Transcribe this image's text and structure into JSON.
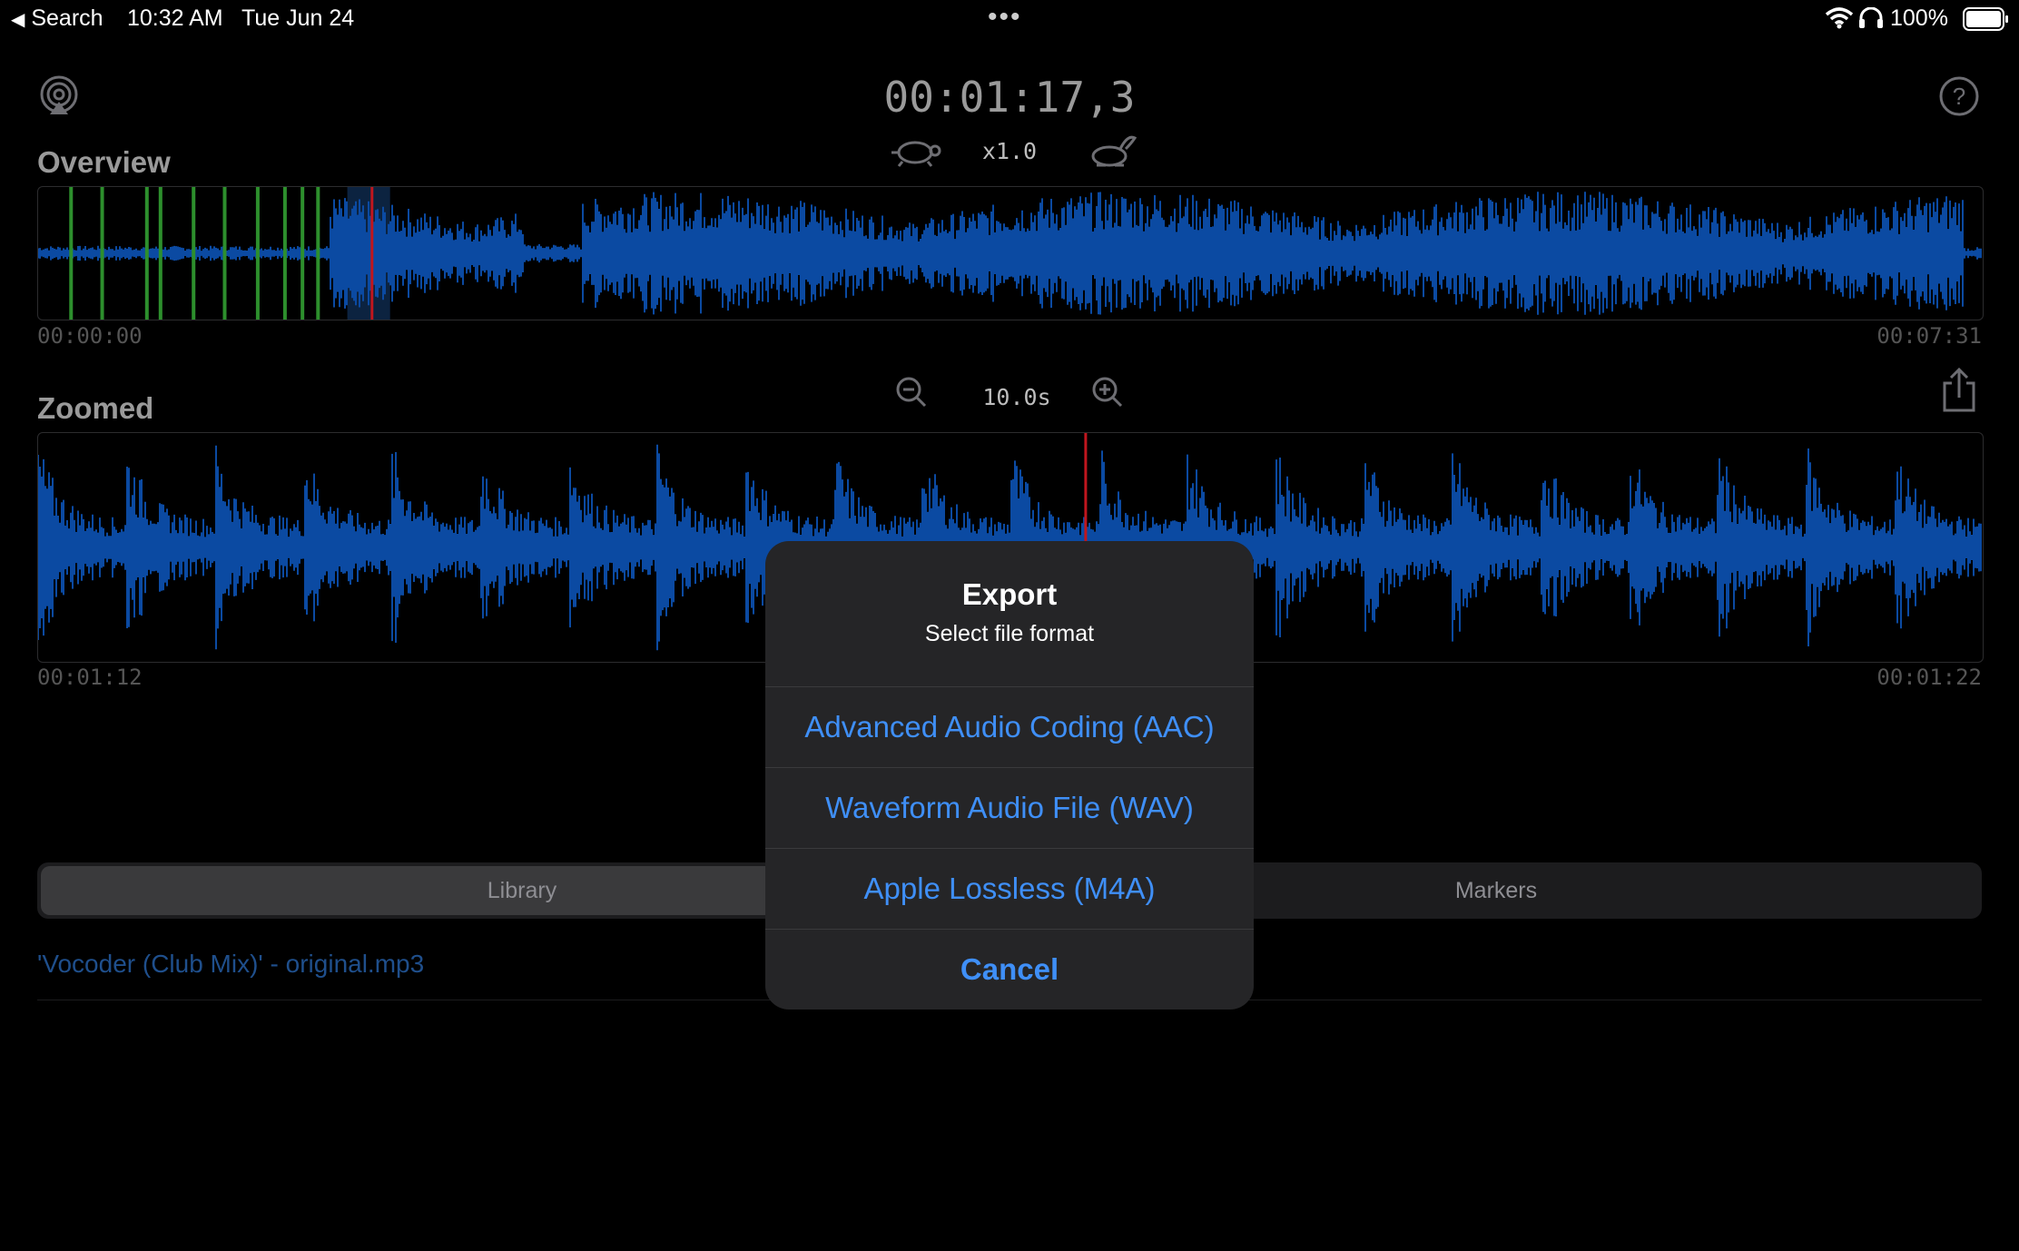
{
  "status_bar": {
    "back_label": "Search",
    "time": "10:32 AM",
    "date": "Tue Jun 24",
    "battery": "100%"
  },
  "player": {
    "timecode": "00:01:17,3",
    "playback_rate": "x1.0"
  },
  "overview": {
    "title": "Overview",
    "start_time": "00:00:00",
    "end_time": "00:07:31",
    "playhead_fraction": 0.171,
    "visible_window_fraction": [
      0.159,
      0.181
    ]
  },
  "zoomed": {
    "title": "Zoomed",
    "zoom_level": "10.0s",
    "start_time": "00:01:12",
    "end_time": "00:01:22",
    "playhead_fraction": 0.538
  },
  "tabs": {
    "library": "Library",
    "markers": "Markers",
    "selected": "library"
  },
  "library": {
    "items": [
      "'Vocoder (Club Mix)' - original.mp3"
    ]
  },
  "export_dialog": {
    "title": "Export",
    "message": "Select file format",
    "options": [
      "Advanced Audio Coding (AAC)",
      "Waveform Audio File (WAV)",
      "Apple Lossless (M4A)"
    ],
    "cancel": "Cancel"
  },
  "colors": {
    "waveform": "#0b4aa2",
    "playhead": "#c0161d",
    "marker": "#2d8f2d",
    "accent": "#3f8ff7"
  },
  "icons": {
    "airplay": "airplay-icon",
    "help": "help-icon",
    "slower": "turtle-icon",
    "faster": "rabbit-icon",
    "zoom_out": "zoom-out-icon",
    "zoom_in": "zoom-in-icon",
    "share": "share-icon"
  }
}
